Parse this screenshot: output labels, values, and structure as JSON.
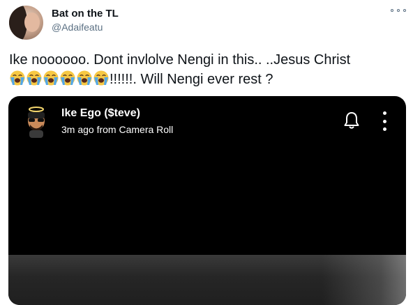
{
  "author": {
    "name": "Bat on the TL",
    "handle": "@Adaifeatu"
  },
  "tweet": {
    "line1": "Ike noooooo.  Dont  invlolve Nengi in this.. ..Jesus Christ",
    "emoji_count": 6,
    "emoji_name": "loudly-crying-face",
    "line2_tail": "!!!!!!. Will Nengi ever rest ?"
  },
  "media": {
    "poster_name": "Ike Ego ($teve)",
    "poster_meta": "3m ago from Camera Roll"
  },
  "colors": {
    "handle": "#5b7083",
    "text": "#0f1419",
    "media_bg": "#000000",
    "emoji_face": "#f7c844",
    "tears": "#53a8e8"
  }
}
